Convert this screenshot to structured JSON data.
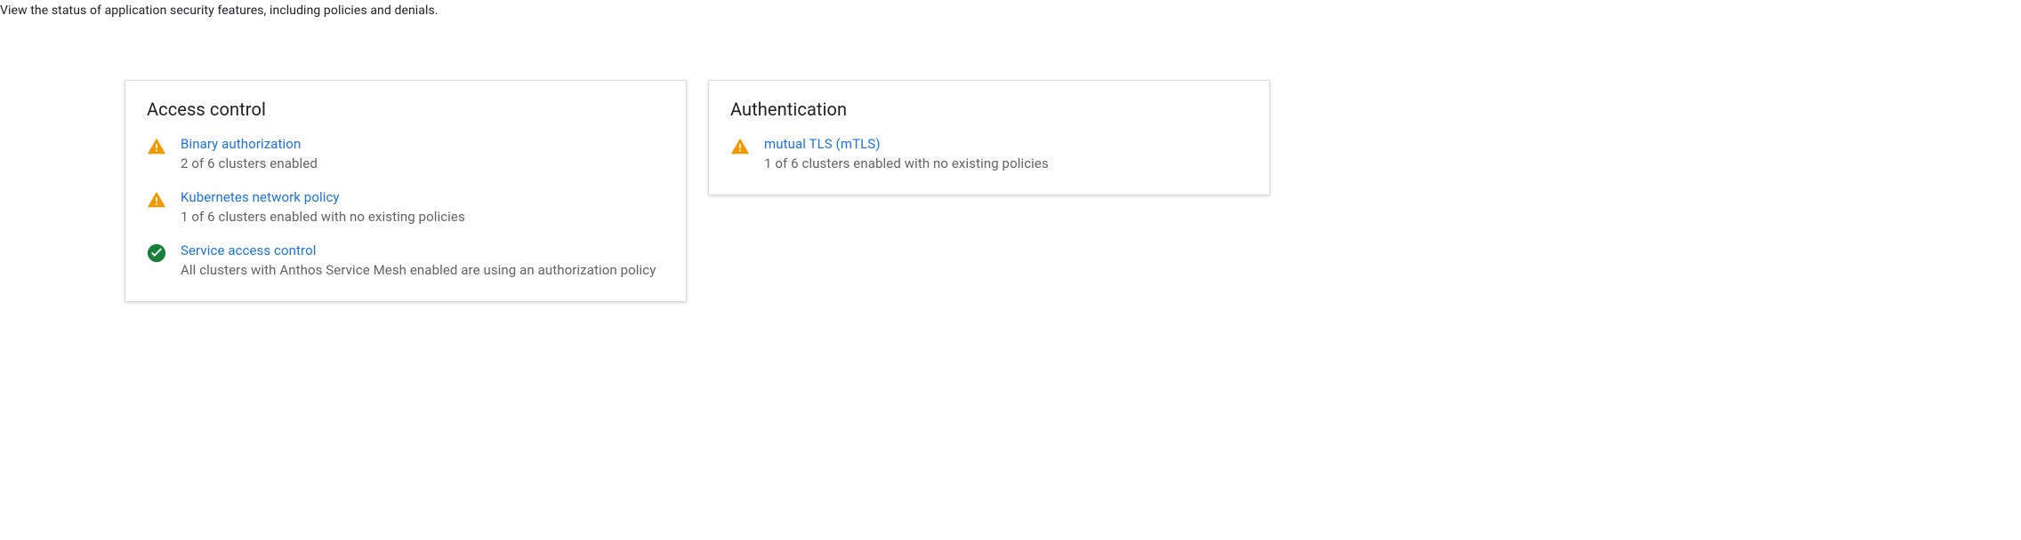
{
  "description": "View the status of application security features, including policies and denials.",
  "cards": {
    "access_control": {
      "title": "Access control",
      "items": [
        {
          "icon": "warning",
          "link_text": "Binary authorization",
          "status": "2 of 6 clusters enabled"
        },
        {
          "icon": "warning",
          "link_text": "Kubernetes network policy",
          "status": "1 of 6 clusters enabled with no existing policies"
        },
        {
          "icon": "success",
          "link_text": "Service access control",
          "status": "All clusters with Anthos Service Mesh enabled are using an authorization policy"
        }
      ]
    },
    "authentication": {
      "title": "Authentication",
      "items": [
        {
          "icon": "warning",
          "link_text": "mutual TLS (mTLS)",
          "status": "1 of 6 clusters enabled with no existing policies"
        }
      ]
    }
  }
}
